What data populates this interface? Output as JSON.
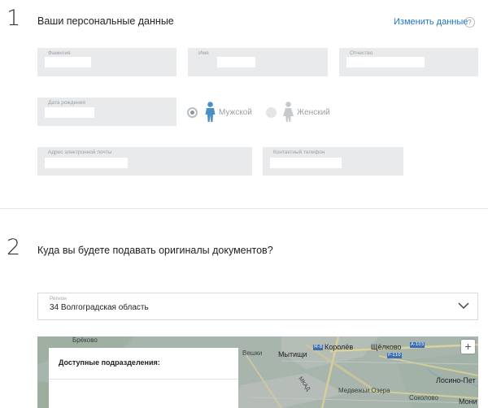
{
  "section1": {
    "number": "1",
    "title": "Ваши персональные данные",
    "edit_link": "Изменить данные",
    "help_glyph": "?",
    "fields": {
      "surname": {
        "label": "Фамилия"
      },
      "name": {
        "label": "Имя"
      },
      "patronymic": {
        "label": "Отчество"
      },
      "birthdate": {
        "label": "Дата рождения"
      },
      "email": {
        "label": "Адрес электронной почты"
      },
      "phone": {
        "label": "Контактный телефон"
      }
    },
    "gender": {
      "male_label": "Мужской",
      "female_label": "Женский",
      "selected": "male"
    }
  },
  "section2": {
    "number": "2",
    "title": "Куда вы будете подавать оригиналы документов?",
    "region": {
      "label": "Регион",
      "value": "34 Волгоградская область"
    },
    "map": {
      "units_title": "Доступные подразделения:",
      "zoom_in": "+",
      "places": {
        "brekovo": "Брёково",
        "veshki": "Вешки",
        "mytishchi": "Мытищи",
        "korolev": "Королёв",
        "shchelkovo": "Щёлково",
        "losino": "Лосино-Пет",
        "medvezhi": "Медвежьи Озера",
        "sokolovo": "Соколово",
        "moni": "Мони",
        "mkad": "МКАД"
      },
      "routes": {
        "m8": "М-8",
        "a103": "А-103",
        "r110": "Р-110"
      }
    }
  },
  "colors": {
    "link": "#1e74c4",
    "field_bg": "#e8eaec",
    "male_icon": "#4a90c8",
    "female_icon": "#c7cacd"
  }
}
